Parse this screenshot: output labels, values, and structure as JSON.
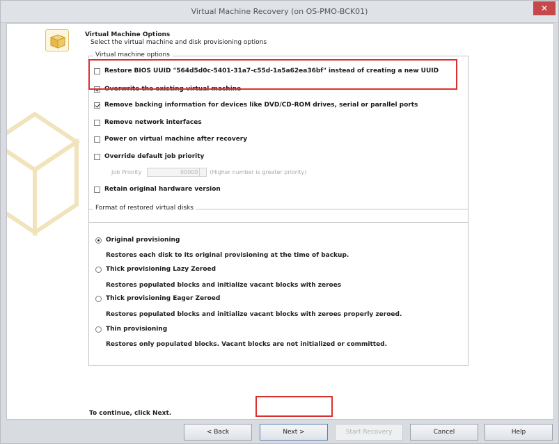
{
  "window": {
    "title": "Virtual Machine Recovery (on OS-PMO-BCK01)",
    "close_symbol": "✕"
  },
  "header": {
    "title": "Virtual Machine Options",
    "subtitle": "Select the virtual machine and disk provisioning options"
  },
  "vm_options": {
    "legend": "Virtual machine options",
    "items": [
      {
        "label": "Restore BIOS UUID \"564d5d0c-5401-31a7-c55d-1a5a62ea36bf\" instead of creating a new UUID",
        "checked": false
      },
      {
        "label": "Overwrite the existing virtual machine",
        "checked": true
      },
      {
        "label": "Remove backing information for devices like DVD/CD-ROM drives, serial or parallel ports",
        "checked": true
      },
      {
        "label": "Remove network interfaces",
        "checked": false
      },
      {
        "label": "Power on virtual machine after recovery",
        "checked": false
      },
      {
        "label": "Override default job priority",
        "checked": false
      },
      {
        "label": "Retain original hardware version",
        "checked": false
      }
    ],
    "job_priority": {
      "label": "Job Priority",
      "value": "90000",
      "hint": "(Higher number is greater priority)"
    }
  },
  "disk_format": {
    "legend": "Format of restored virtual disks",
    "options": [
      {
        "label": "Original provisioning",
        "desc": "Restores each disk to its original provisioning at the time of backup.",
        "selected": true
      },
      {
        "label": "Thick provisioning Lazy Zeroed",
        "desc": "Restores populated blocks and initialize vacant blocks with zeroes",
        "selected": false
      },
      {
        "label": "Thick provisioning Eager Zeroed",
        "desc": "Restores populated blocks and initialize vacant blocks with zeroes properly zeroed.",
        "selected": false
      },
      {
        "label": "Thin provisioning",
        "desc": "Restores only populated blocks. Vacant blocks are not initialized or committed.",
        "selected": false
      }
    ]
  },
  "footer": {
    "instruction": "To continue, click Next."
  },
  "buttons": {
    "back": "< Back",
    "next": "Next >",
    "start_recovery": "Start Recovery",
    "cancel": "Cancel",
    "help": "Help"
  },
  "colors": {
    "highlight": "#d9312f",
    "close_button": "#c7484a"
  },
  "icons": {
    "wizard": "wizard-box-icon",
    "close": "close-icon"
  }
}
